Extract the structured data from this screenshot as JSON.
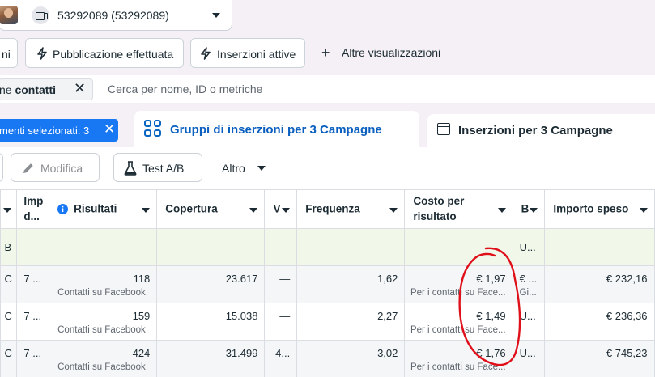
{
  "account": {
    "name": "53292089 (53292089)"
  },
  "filters": [
    {
      "label": "ni"
    },
    {
      "label": "Pubblicazione effettuata"
    },
    {
      "label": "Inserzioni attive"
    }
  ],
  "more_views_label": "Altre visualizzazioni",
  "search": {
    "chip_prefix": "ne ",
    "chip_bold": "contatti",
    "placeholder": "Cerca per nome, ID o metriche"
  },
  "tabs": {
    "selection_badge": "menti selezionati: 3",
    "active": "Gruppi di inserzioni per 3 Campagne",
    "inactive": "Inserzioni per 3 Campagne"
  },
  "actions": {
    "edit": "Modifica",
    "ab_test": "Test A/B",
    "more": "Altro"
  },
  "table": {
    "headers": {
      "impr_line1": "Imp",
      "impr_line2": "d...",
      "results": "Risultati",
      "reach": "Copertura",
      "v": "V",
      "frequency": "Frequenza",
      "cost_line1": "Costo per",
      "cost_line2": "risultato",
      "b": "B",
      "amount": "Importo speso"
    },
    "summary": {
      "c0": "B",
      "c1": "—",
      "results": "—",
      "reach": "—",
      "v": "—",
      "frequency": "—",
      "cost": "—",
      "b": "U...",
      "amount": "—"
    },
    "rows": [
      {
        "c0": "C",
        "c1": "7 ...",
        "results": "118",
        "results_sub": "Contatti su Facebook",
        "reach": "23.617",
        "v": "—",
        "frequency": "1,62",
        "cost": "€ 1,97",
        "cost_sub": "Per i contatti su Face...",
        "b": "€ ...",
        "b_sub": "Gi...",
        "amount": "€ 232,16"
      },
      {
        "c0": "C",
        "c1": "7 ...",
        "results": "159",
        "results_sub": "Contatti su Facebook",
        "reach": "15.038",
        "v": "—",
        "frequency": "2,27",
        "cost": "€ 1,49",
        "cost_sub": "Per i contatti su Face...",
        "b": "U...",
        "b_sub": "",
        "amount": "€ 236,36"
      },
      {
        "c0": "C",
        "c1": "7 ...",
        "results": "424",
        "results_sub": "Contatti su Facebook",
        "reach": "31.499",
        "v": "4...",
        "frequency": "3,02",
        "cost": "€ 1,76",
        "cost_sub": "Per i contatti su Face...",
        "b": "U...",
        "b_sub": "",
        "amount": "€ 745,23"
      }
    ]
  },
  "colors": {
    "accent": "#1877f2",
    "active_tab_text": "#0a5fbf",
    "summary_row_bg": "#f1f8e9",
    "annotation": "#e0101a"
  },
  "icons": [
    "avatar",
    "ad-account-icon",
    "chevron-down-icon",
    "bolt-icon",
    "plus-icon",
    "close-icon",
    "info-icon",
    "grid-icon",
    "window-icon",
    "pencil-icon",
    "flask-icon"
  ]
}
